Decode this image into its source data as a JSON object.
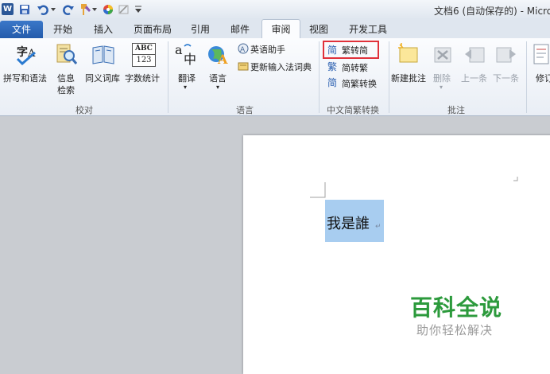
{
  "window": {
    "title": "文档6 (自动保存的) - Micro"
  },
  "quick_access": {
    "app_icon": "W"
  },
  "tabs": {
    "file": "文件",
    "items": [
      {
        "label": "开始"
      },
      {
        "label": "插入"
      },
      {
        "label": "页面布局"
      },
      {
        "label": "引用"
      },
      {
        "label": "邮件"
      },
      {
        "label": "审阅"
      },
      {
        "label": "视图"
      },
      {
        "label": "开发工具"
      }
    ],
    "active": "审阅"
  },
  "ribbon": {
    "proofing": {
      "group_label": "校对",
      "spelling": "拼写和语法",
      "research_line1": "信息",
      "research_line2": "检索",
      "thesaurus": "同义词库",
      "word_count": "字数统计",
      "word_count_icon_top": "ABC",
      "word_count_icon_bottom": "123"
    },
    "language": {
      "group_label": "语言",
      "translate": "翻译",
      "translate_arrow": "▾",
      "language_btn": "语言",
      "language_arrow": "▾",
      "english_assistant": "英语助手",
      "update_ime": "更新输入法词典"
    },
    "chinese_conversion": {
      "group_label": "中文简繁转换",
      "trad_to_simp": "繁转简",
      "simp_to_trad": "简转繁",
      "convert": "简繁转换"
    },
    "comments": {
      "group_label": "批注",
      "new_comment": "新建批注",
      "delete": "删除",
      "delete_arrow": "▾",
      "previous": "上一条",
      "next": "下一条"
    },
    "tracking": {
      "modify_partial": "修订"
    }
  },
  "document": {
    "text": "我是誰",
    "paragraph_mark": "↵"
  },
  "watermark": {
    "title": "百科全说",
    "subtitle": "助你轻松解决"
  },
  "colors": {
    "accent": "#2b5797",
    "selection": "#a8cdf0",
    "highlight_box": "#e0313a",
    "watermark_green": "#2c9a3c"
  }
}
